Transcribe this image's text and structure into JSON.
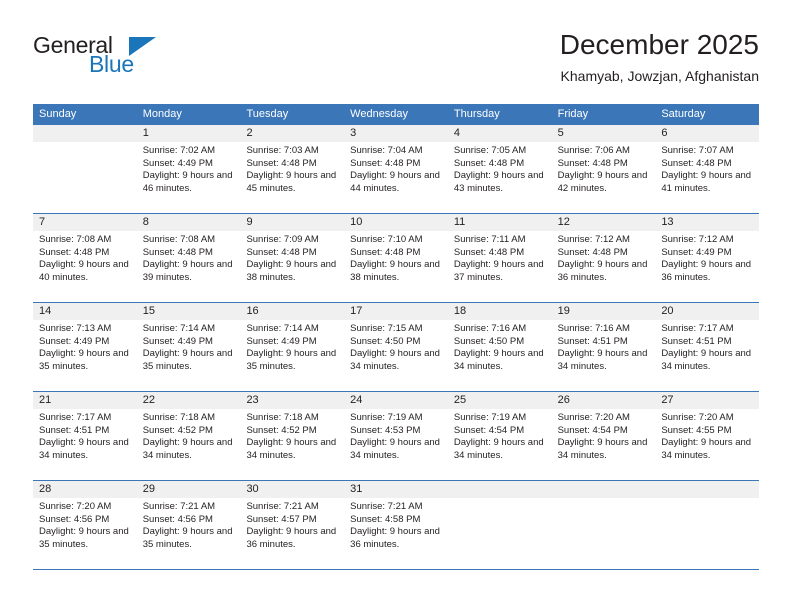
{
  "brand": {
    "name_part1": "General",
    "name_part2": "Blue",
    "triangle_icon": "triangle-icon",
    "accent_color": "#1b75bb"
  },
  "header": {
    "title": "December 2025",
    "subtitle": "Khamyab, Jowzjan, Afghanistan"
  },
  "calendar": {
    "header_color": "#3a76b8",
    "daynum_band_color": "#f0f0f0",
    "weekdays": [
      "Sunday",
      "Monday",
      "Tuesday",
      "Wednesday",
      "Thursday",
      "Friday",
      "Saturday"
    ],
    "weeks": [
      [
        {
          "day": "",
          "sunrise": "",
          "sunset": "",
          "daylight": ""
        },
        {
          "day": "1",
          "sunrise": "Sunrise: 7:02 AM",
          "sunset": "Sunset: 4:49 PM",
          "daylight": "Daylight: 9 hours and 46 minutes."
        },
        {
          "day": "2",
          "sunrise": "Sunrise: 7:03 AM",
          "sunset": "Sunset: 4:48 PM",
          "daylight": "Daylight: 9 hours and 45 minutes."
        },
        {
          "day": "3",
          "sunrise": "Sunrise: 7:04 AM",
          "sunset": "Sunset: 4:48 PM",
          "daylight": "Daylight: 9 hours and 44 minutes."
        },
        {
          "day": "4",
          "sunrise": "Sunrise: 7:05 AM",
          "sunset": "Sunset: 4:48 PM",
          "daylight": "Daylight: 9 hours and 43 minutes."
        },
        {
          "day": "5",
          "sunrise": "Sunrise: 7:06 AM",
          "sunset": "Sunset: 4:48 PM",
          "daylight": "Daylight: 9 hours and 42 minutes."
        },
        {
          "day": "6",
          "sunrise": "Sunrise: 7:07 AM",
          "sunset": "Sunset: 4:48 PM",
          "daylight": "Daylight: 9 hours and 41 minutes."
        }
      ],
      [
        {
          "day": "7",
          "sunrise": "Sunrise: 7:08 AM",
          "sunset": "Sunset: 4:48 PM",
          "daylight": "Daylight: 9 hours and 40 minutes."
        },
        {
          "day": "8",
          "sunrise": "Sunrise: 7:08 AM",
          "sunset": "Sunset: 4:48 PM",
          "daylight": "Daylight: 9 hours and 39 minutes."
        },
        {
          "day": "9",
          "sunrise": "Sunrise: 7:09 AM",
          "sunset": "Sunset: 4:48 PM",
          "daylight": "Daylight: 9 hours and 38 minutes."
        },
        {
          "day": "10",
          "sunrise": "Sunrise: 7:10 AM",
          "sunset": "Sunset: 4:48 PM",
          "daylight": "Daylight: 9 hours and 38 minutes."
        },
        {
          "day": "11",
          "sunrise": "Sunrise: 7:11 AM",
          "sunset": "Sunset: 4:48 PM",
          "daylight": "Daylight: 9 hours and 37 minutes."
        },
        {
          "day": "12",
          "sunrise": "Sunrise: 7:12 AM",
          "sunset": "Sunset: 4:48 PM",
          "daylight": "Daylight: 9 hours and 36 minutes."
        },
        {
          "day": "13",
          "sunrise": "Sunrise: 7:12 AM",
          "sunset": "Sunset: 4:49 PM",
          "daylight": "Daylight: 9 hours and 36 minutes."
        }
      ],
      [
        {
          "day": "14",
          "sunrise": "Sunrise: 7:13 AM",
          "sunset": "Sunset: 4:49 PM",
          "daylight": "Daylight: 9 hours and 35 minutes."
        },
        {
          "day": "15",
          "sunrise": "Sunrise: 7:14 AM",
          "sunset": "Sunset: 4:49 PM",
          "daylight": "Daylight: 9 hours and 35 minutes."
        },
        {
          "day": "16",
          "sunrise": "Sunrise: 7:14 AM",
          "sunset": "Sunset: 4:49 PM",
          "daylight": "Daylight: 9 hours and 35 minutes."
        },
        {
          "day": "17",
          "sunrise": "Sunrise: 7:15 AM",
          "sunset": "Sunset: 4:50 PM",
          "daylight": "Daylight: 9 hours and 34 minutes."
        },
        {
          "day": "18",
          "sunrise": "Sunrise: 7:16 AM",
          "sunset": "Sunset: 4:50 PM",
          "daylight": "Daylight: 9 hours and 34 minutes."
        },
        {
          "day": "19",
          "sunrise": "Sunrise: 7:16 AM",
          "sunset": "Sunset: 4:51 PM",
          "daylight": "Daylight: 9 hours and 34 minutes."
        },
        {
          "day": "20",
          "sunrise": "Sunrise: 7:17 AM",
          "sunset": "Sunset: 4:51 PM",
          "daylight": "Daylight: 9 hours and 34 minutes."
        }
      ],
      [
        {
          "day": "21",
          "sunrise": "Sunrise: 7:17 AM",
          "sunset": "Sunset: 4:51 PM",
          "daylight": "Daylight: 9 hours and 34 minutes."
        },
        {
          "day": "22",
          "sunrise": "Sunrise: 7:18 AM",
          "sunset": "Sunset: 4:52 PM",
          "daylight": "Daylight: 9 hours and 34 minutes."
        },
        {
          "day": "23",
          "sunrise": "Sunrise: 7:18 AM",
          "sunset": "Sunset: 4:52 PM",
          "daylight": "Daylight: 9 hours and 34 minutes."
        },
        {
          "day": "24",
          "sunrise": "Sunrise: 7:19 AM",
          "sunset": "Sunset: 4:53 PM",
          "daylight": "Daylight: 9 hours and 34 minutes."
        },
        {
          "day": "25",
          "sunrise": "Sunrise: 7:19 AM",
          "sunset": "Sunset: 4:54 PM",
          "daylight": "Daylight: 9 hours and 34 minutes."
        },
        {
          "day": "26",
          "sunrise": "Sunrise: 7:20 AM",
          "sunset": "Sunset: 4:54 PM",
          "daylight": "Daylight: 9 hours and 34 minutes."
        },
        {
          "day": "27",
          "sunrise": "Sunrise: 7:20 AM",
          "sunset": "Sunset: 4:55 PM",
          "daylight": "Daylight: 9 hours and 34 minutes."
        }
      ],
      [
        {
          "day": "28",
          "sunrise": "Sunrise: 7:20 AM",
          "sunset": "Sunset: 4:56 PM",
          "daylight": "Daylight: 9 hours and 35 minutes."
        },
        {
          "day": "29",
          "sunrise": "Sunrise: 7:21 AM",
          "sunset": "Sunset: 4:56 PM",
          "daylight": "Daylight: 9 hours and 35 minutes."
        },
        {
          "day": "30",
          "sunrise": "Sunrise: 7:21 AM",
          "sunset": "Sunset: 4:57 PM",
          "daylight": "Daylight: 9 hours and 36 minutes."
        },
        {
          "day": "31",
          "sunrise": "Sunrise: 7:21 AM",
          "sunset": "Sunset: 4:58 PM",
          "daylight": "Daylight: 9 hours and 36 minutes."
        },
        {
          "day": "",
          "sunrise": "",
          "sunset": "",
          "daylight": ""
        },
        {
          "day": "",
          "sunrise": "",
          "sunset": "",
          "daylight": ""
        },
        {
          "day": "",
          "sunrise": "",
          "sunset": "",
          "daylight": ""
        }
      ]
    ]
  }
}
